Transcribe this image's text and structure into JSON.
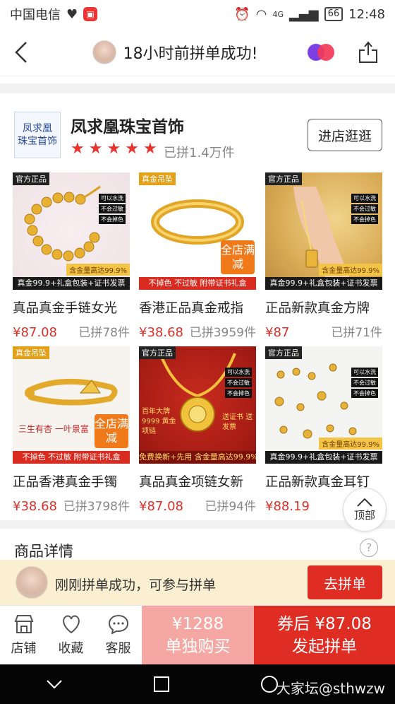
{
  "status_bar": {
    "carrier": "中国电信",
    "battery": "66",
    "time": "12:48",
    "network": "4G"
  },
  "top_nav": {
    "title": "18小时前拼单成功!"
  },
  "shop": {
    "logo_line1": "凤求凰",
    "logo_line2": "珠宝首饰",
    "name": "凤求凰珠宝首饰",
    "rating_stars": 5,
    "sold": "已拼1.4万件",
    "visit_label": "进店逛逛"
  },
  "products": [
    {
      "tag": "官方正品",
      "strip": "真金99.9+礼盒包装+证书发票",
      "chip": "含金量高达99.9%",
      "notes": [
        "可以水洗",
        "不会过敏",
        "不会掉色"
      ],
      "title": "真品真金手链女光",
      "price": "¥87.08",
      "count": "已拼78件"
    },
    {
      "tag": "真金吊坠",
      "strip": "不掉色 不过敏 附带证书礼盒",
      "badge": "全店满减",
      "title": "香港正品真金戒指",
      "price": "¥38.68",
      "count": "已拼3959件"
    },
    {
      "tag": "官方正品",
      "strip": "真金99.9+礼盒包装+证书发票",
      "chip": "含金量高达99.9%",
      "notes": [
        "可以水洗",
        "不会过敏",
        "不会掉色"
      ],
      "title": "正品新款真金方牌",
      "price": "¥87",
      "count": "已拼71件"
    },
    {
      "tag": "真金吊坠",
      "strip": "不掉色 不过敏 附带证书礼盒",
      "badge": "全店满减",
      "caption": "三生有杏 一叶景富",
      "title": "正品香港真金手镯",
      "price": "¥38.68",
      "count": "已拼3798件"
    },
    {
      "tag": "官方正品",
      "strip": "免费换新+先用 含金量高达99.9%",
      "notes": [
        "可以水洗",
        "不会过敏",
        "不会掉色"
      ],
      "left_text": "百年大牌 9999 黄金项链",
      "right_text": "送证书 送发票",
      "title": "真品真金项链女新",
      "price": "¥87.08",
      "count": "已拼94件"
    },
    {
      "tag": "官方正品",
      "strip": "真金99.9+礼盒包装+证书发票",
      "chip": "含金量高达99.9%",
      "notes": [
        "可以水洗",
        "不会过敏",
        "不会掉色"
      ],
      "title": "正品新款真金耳钉",
      "price": "¥88.19",
      "count": "已拼"
    }
  ],
  "to_top_label": "顶部",
  "details": {
    "title": "商品详情"
  },
  "banner": {
    "text": "刚刚拼单成功，可参与拼单",
    "button": "去拼单"
  },
  "actions": {
    "shop": "店铺",
    "favorite": "收藏",
    "service": "客服"
  },
  "buy_single": {
    "price": "¥1288",
    "label": "单独购买"
  },
  "buy_group": {
    "price": "券后 ¥87.08",
    "label": "发起拼单"
  },
  "watermark": "大家坛@sthwzw",
  "colors": {
    "accent_red": "#e02d24",
    "price_red": "#d9302a",
    "banner_bg": "#fbefd2",
    "single_buy_bg": "#f5a8a3"
  }
}
